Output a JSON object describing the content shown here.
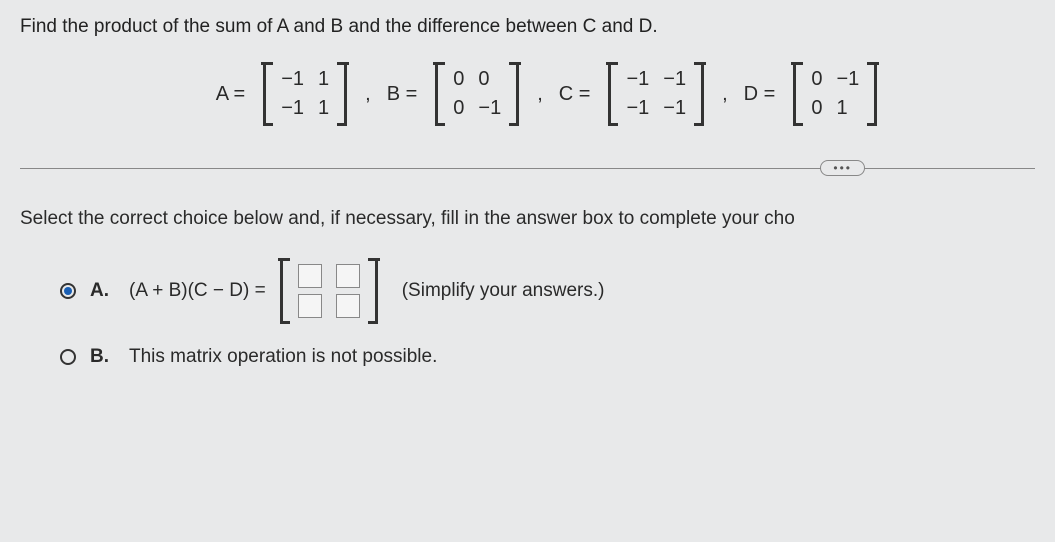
{
  "question": "Find the product of the sum of A and B and the difference between C and D.",
  "matrices": {
    "A": {
      "label": "A =",
      "rows": [
        [
          "−1",
          "1"
        ],
        [
          "−1",
          "1"
        ]
      ]
    },
    "B": {
      "label": "B =",
      "rows": [
        [
          "0",
          "0"
        ],
        [
          "0",
          "−1"
        ]
      ]
    },
    "C": {
      "label": "C =",
      "rows": [
        [
          "−1",
          "−1"
        ],
        [
          "−1",
          "−1"
        ]
      ]
    },
    "D": {
      "label": "D =",
      "rows": [
        [
          "0",
          "−1"
        ],
        [
          "0",
          "1"
        ]
      ]
    }
  },
  "separator": ",",
  "divider_label": "•••",
  "instruction": "Select the correct choice below and, if necessary, fill in the answer box to complete your cho",
  "choices": {
    "A": {
      "letter": "A.",
      "expression": "(A + B)(C − D)  =",
      "hint": "(Simplify your answers.)",
      "selected": true
    },
    "B": {
      "letter": "B.",
      "text": "This matrix operation is not possible.",
      "selected": false
    }
  },
  "chart_data": {
    "type": "table",
    "title": "Matrix definitions",
    "series": [
      {
        "name": "A",
        "values": [
          [
            -1,
            1
          ],
          [
            -1,
            1
          ]
        ]
      },
      {
        "name": "B",
        "values": [
          [
            0,
            0
          ],
          [
            0,
            -1
          ]
        ]
      },
      {
        "name": "C",
        "values": [
          [
            -1,
            -1
          ],
          [
            -1,
            -1
          ]
        ]
      },
      {
        "name": "D",
        "values": [
          [
            0,
            -1
          ],
          [
            0,
            1
          ]
        ]
      }
    ]
  }
}
